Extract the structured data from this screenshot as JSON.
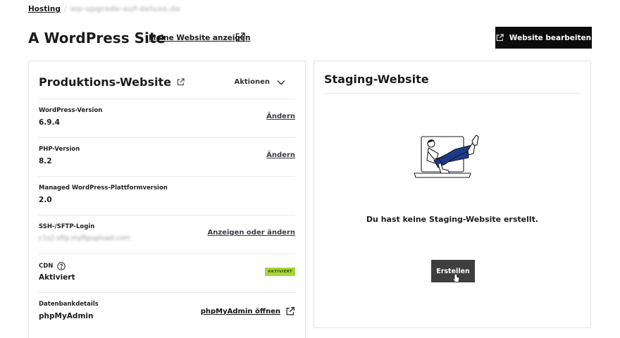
{
  "breadcrumb": {
    "root": "Hosting",
    "separator": "/",
    "current": "wp-upgrade-auf-deluxe.de"
  },
  "header": {
    "title": "A WordPress Site",
    "view_link": "Meine Website anzeigen",
    "edit_button": "Website bearbeiten"
  },
  "production": {
    "title": "Produktions-Website",
    "actions_label": "Aktionen",
    "rows": [
      {
        "label": "WordPress-Version",
        "value": "6.9.4",
        "link": "Ändern"
      },
      {
        "label": "PHP-Version",
        "value": "8.2",
        "link": "Ändern"
      },
      {
        "label": "Managed WordPress-Plattformversion",
        "value": "2.0"
      },
      {
        "label": "SSH-/SFTP-Login",
        "value": "c1s2.sftp.myftpupload.com",
        "link": "Anzeigen oder ändern"
      },
      {
        "label": "CDN",
        "value": "Aktiviert",
        "badge": "AKTIVIERT"
      },
      {
        "label": "Datenbankdetails",
        "value": "phpMyAdmin",
        "link": "phpMyAdmin öffnen"
      }
    ]
  },
  "staging": {
    "title": "Staging-Website",
    "empty_message": "Du hast keine Staging-Website erstellt.",
    "create_button": "Erstellen"
  },
  "colors": {
    "primary_button": "#0c0c0c",
    "create_button": "#3e3e3e",
    "badge": "#a6d63a",
    "illustration_accent": "#1e3a8a"
  }
}
